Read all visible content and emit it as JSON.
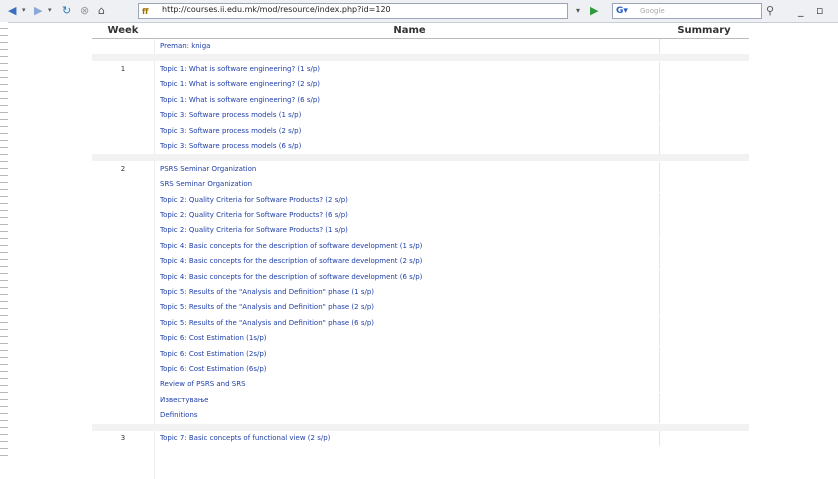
{
  "browser": {
    "url": "http://courses.ii.edu.mk/mod/resource/index.php?id=120",
    "search_placeholder": "Google",
    "icons": [
      "back-icon",
      "forward-icon",
      "reload-icon",
      "stop-icon",
      "home-icon",
      "site-icon",
      "go-icon",
      "search-engine-icon",
      "search-icon",
      "minimize-icon",
      "maximize-icon"
    ]
  },
  "table": {
    "headers": {
      "week": "Week",
      "name": "Name",
      "summary": "Summary"
    },
    "sections": [
      {
        "week": "",
        "items": [
          "Preman: kniga"
        ]
      },
      {
        "week": "1",
        "items": [
          "Topic 1: What is software engineering? (1 s/p)",
          "Topic 1: What is software engineering? (2 s/p)",
          "Topic 1: What is software engineering? (6 s/p)",
          "Topic 3: Software process models (1 s/p)",
          "Topic 3: Software process models (2 s/p)",
          "Topic 3: Software process models (6 s/p)"
        ]
      },
      {
        "week": "2",
        "items": [
          "PSRS Seminar Organization",
          "SRS Seminar Organization",
          "Topic 2: Quality Criteria for Software Products? (2 s/p)",
          "Topic 2: Quality Criteria for Software Products? (6 s/p)",
          "Topic 2: Quality Criteria for Software Products? (1 s/p)",
          "Topic 4: Basic concepts for the description of software development (1 s/p)",
          "Topic 4: Basic concepts for the description of software development (2 s/p)",
          "Topic 4: Basic concepts for the description of software development (6 s/p)",
          "Topic 5: Results of the \"Analysis and Definition\" phase (1 s/p)",
          "Topic 5: Results of the \"Analysis and Definition\" phase (2 s/p)",
          "Topic 5: Results of the \"Analysis and Definition\" phase (6 s/p)",
          "Topic 6: Cost Estimation (1s/p)",
          "Topic 6: Cost Estimation (2s/p)",
          "Topic 6: Cost Estimation (6s/p)",
          "Review of PSRS and SRS",
          "Известување",
          "Definitions"
        ]
      },
      {
        "week": "3",
        "items": [
          "Topic 7: Basic concepts of functional view (2 s/p)"
        ]
      }
    ]
  }
}
